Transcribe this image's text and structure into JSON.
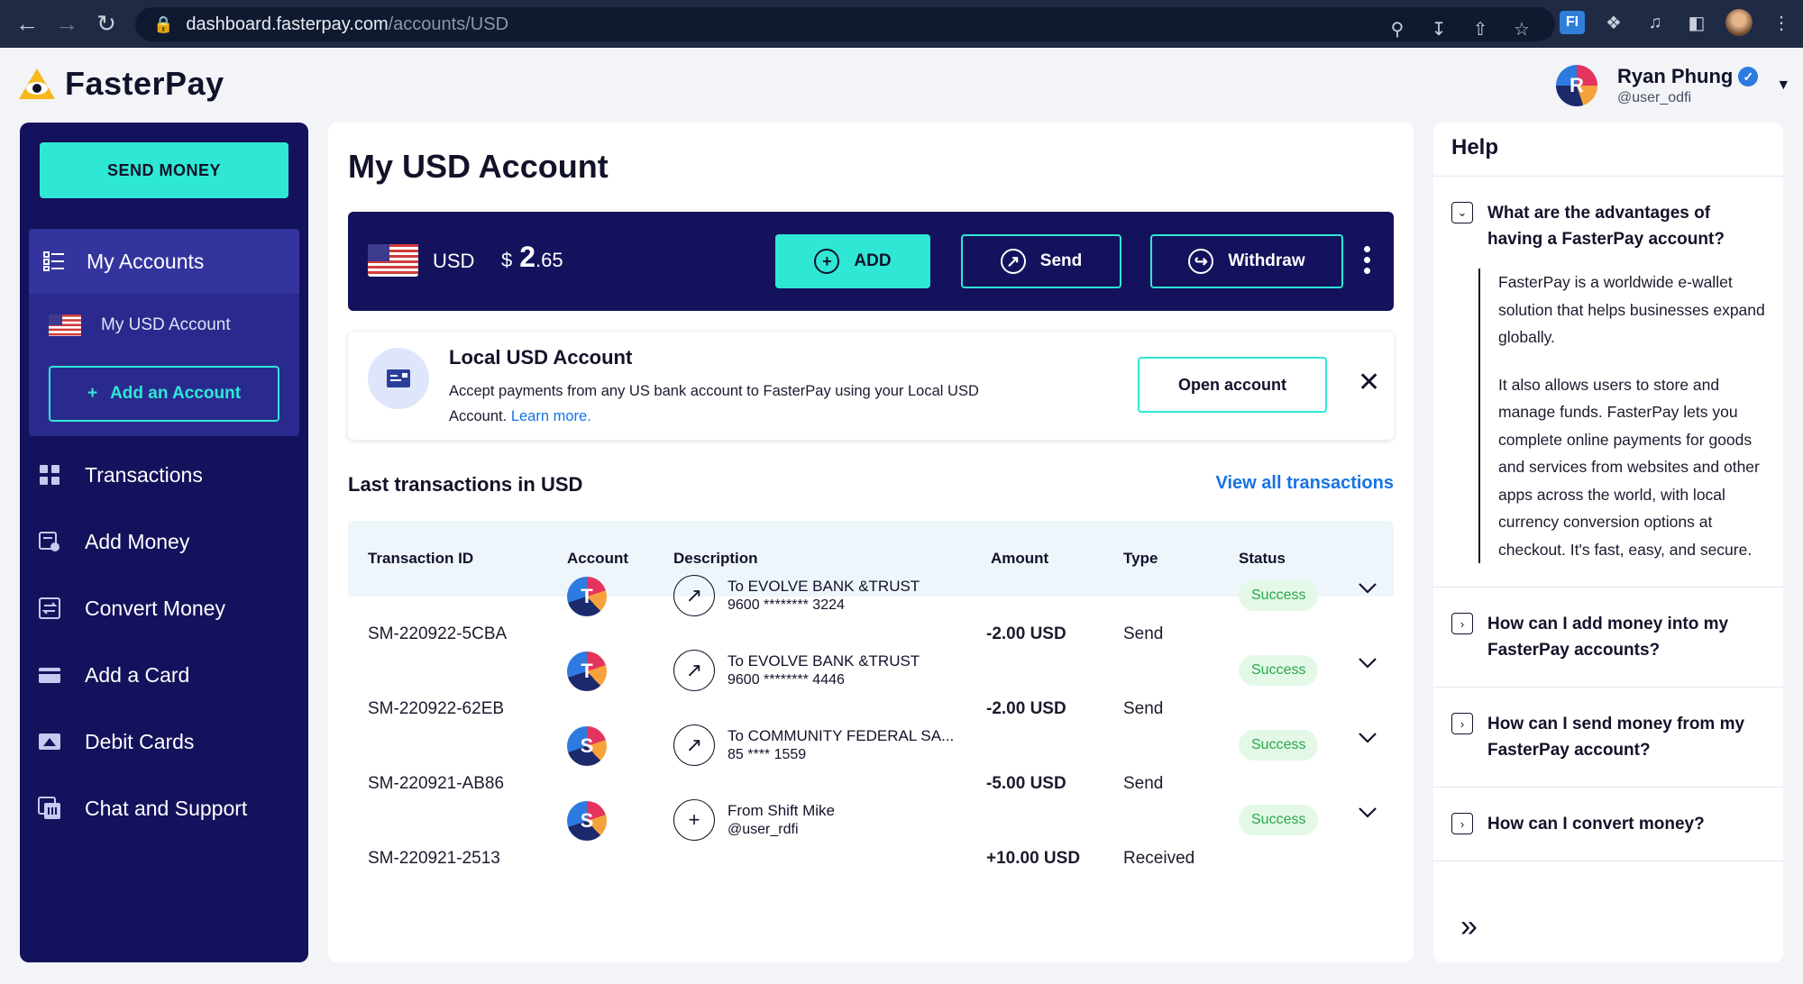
{
  "browser": {
    "url_host": "dashboard.fasterpay.com",
    "url_path": "/accounts/USD",
    "ext_label": "FI"
  },
  "header": {
    "brand": "FasterPay",
    "user": {
      "initial": "R",
      "name": "Ryan Phung",
      "handle": "@user_odfi"
    }
  },
  "sidebar": {
    "send_money": "SEND MONEY",
    "my_accounts": "My Accounts",
    "usd_account": "My USD Account",
    "add_account": "Add an Account",
    "nav": [
      {
        "label": "Transactions",
        "icon": "grid-icon"
      },
      {
        "label": "Add Money",
        "icon": "add-money-icon"
      },
      {
        "label": "Convert Money",
        "icon": "convert-icon"
      },
      {
        "label": "Add a Card",
        "icon": "card-icon"
      },
      {
        "label": "Debit Cards",
        "icon": "debit-card-icon"
      },
      {
        "label": "Chat and Support",
        "icon": "chat-icon"
      }
    ]
  },
  "main": {
    "title": "My USD Account",
    "balance": {
      "currency": "USD",
      "symbol": "$",
      "whole": "2",
      "decimal": ".65",
      "add_label": "ADD",
      "send_label": "Send",
      "withdraw_label": "Withdraw"
    },
    "promo": {
      "title": "Local USD Account",
      "desc": "Accept payments from any US bank account to FasterPay using your Local USD Account.",
      "link": "Learn more.",
      "button": "Open account"
    },
    "transactions": {
      "title": "Last transactions in USD",
      "view_all": "View all transactions",
      "headers": {
        "id": "Transaction ID",
        "account": "Account",
        "description": "Description",
        "amount": "Amount",
        "type": "Type",
        "status": "Status"
      },
      "rows": [
        {
          "id": "SM-220922-5CBA",
          "account": "T",
          "desc1": "To EVOLVE BANK &TRUST",
          "desc2": "9600 ******** 3224",
          "icon": "arrow-up-right-icon",
          "amount": "-2.00 USD",
          "type": "Send",
          "status": "Success"
        },
        {
          "id": "SM-220922-62EB",
          "account": "T",
          "desc1": "To EVOLVE BANK &TRUST",
          "desc2": "9600 ******** 4446",
          "icon": "arrow-up-right-icon",
          "amount": "-2.00 USD",
          "type": "Send",
          "status": "Success"
        },
        {
          "id": "SM-220921-AB86",
          "account": "S",
          "desc1": "To COMMUNITY FEDERAL SA...",
          "desc2": "85 **** 1559",
          "icon": "arrow-up-right-icon",
          "amount": "-5.00 USD",
          "type": "Send",
          "status": "Success"
        },
        {
          "id": "SM-220921-2513",
          "account": "S",
          "desc1": "From Shift Mike",
          "desc2": "@user_rdfi",
          "icon": "plus-icon",
          "amount": "+10.00 USD",
          "type": "Received",
          "status": "Success"
        }
      ]
    }
  },
  "help": {
    "title": "Help",
    "faqs": [
      {
        "q": "What are the advantages of having a FasterPay account?",
        "a1": "FasterPay is a worldwide e-wallet solution that helps businesses expand globally.",
        "a2": "It also allows users to store and manage funds. FasterPay lets you complete online payments for goods and services from websites and other apps across the world, with local currency conversion options at checkout. It's fast, easy, and secure."
      },
      {
        "q": "How can I add money into my FasterPay accounts?"
      },
      {
        "q": "How can I send money from my FasterPay account?"
      },
      {
        "q": "How can I convert money?"
      }
    ]
  },
  "colors": {
    "navy": "#14125c",
    "teal": "#2ee8d5",
    "link": "#1673e6",
    "success_bg": "#e3f8e7",
    "success_text": "#2ba64c"
  }
}
